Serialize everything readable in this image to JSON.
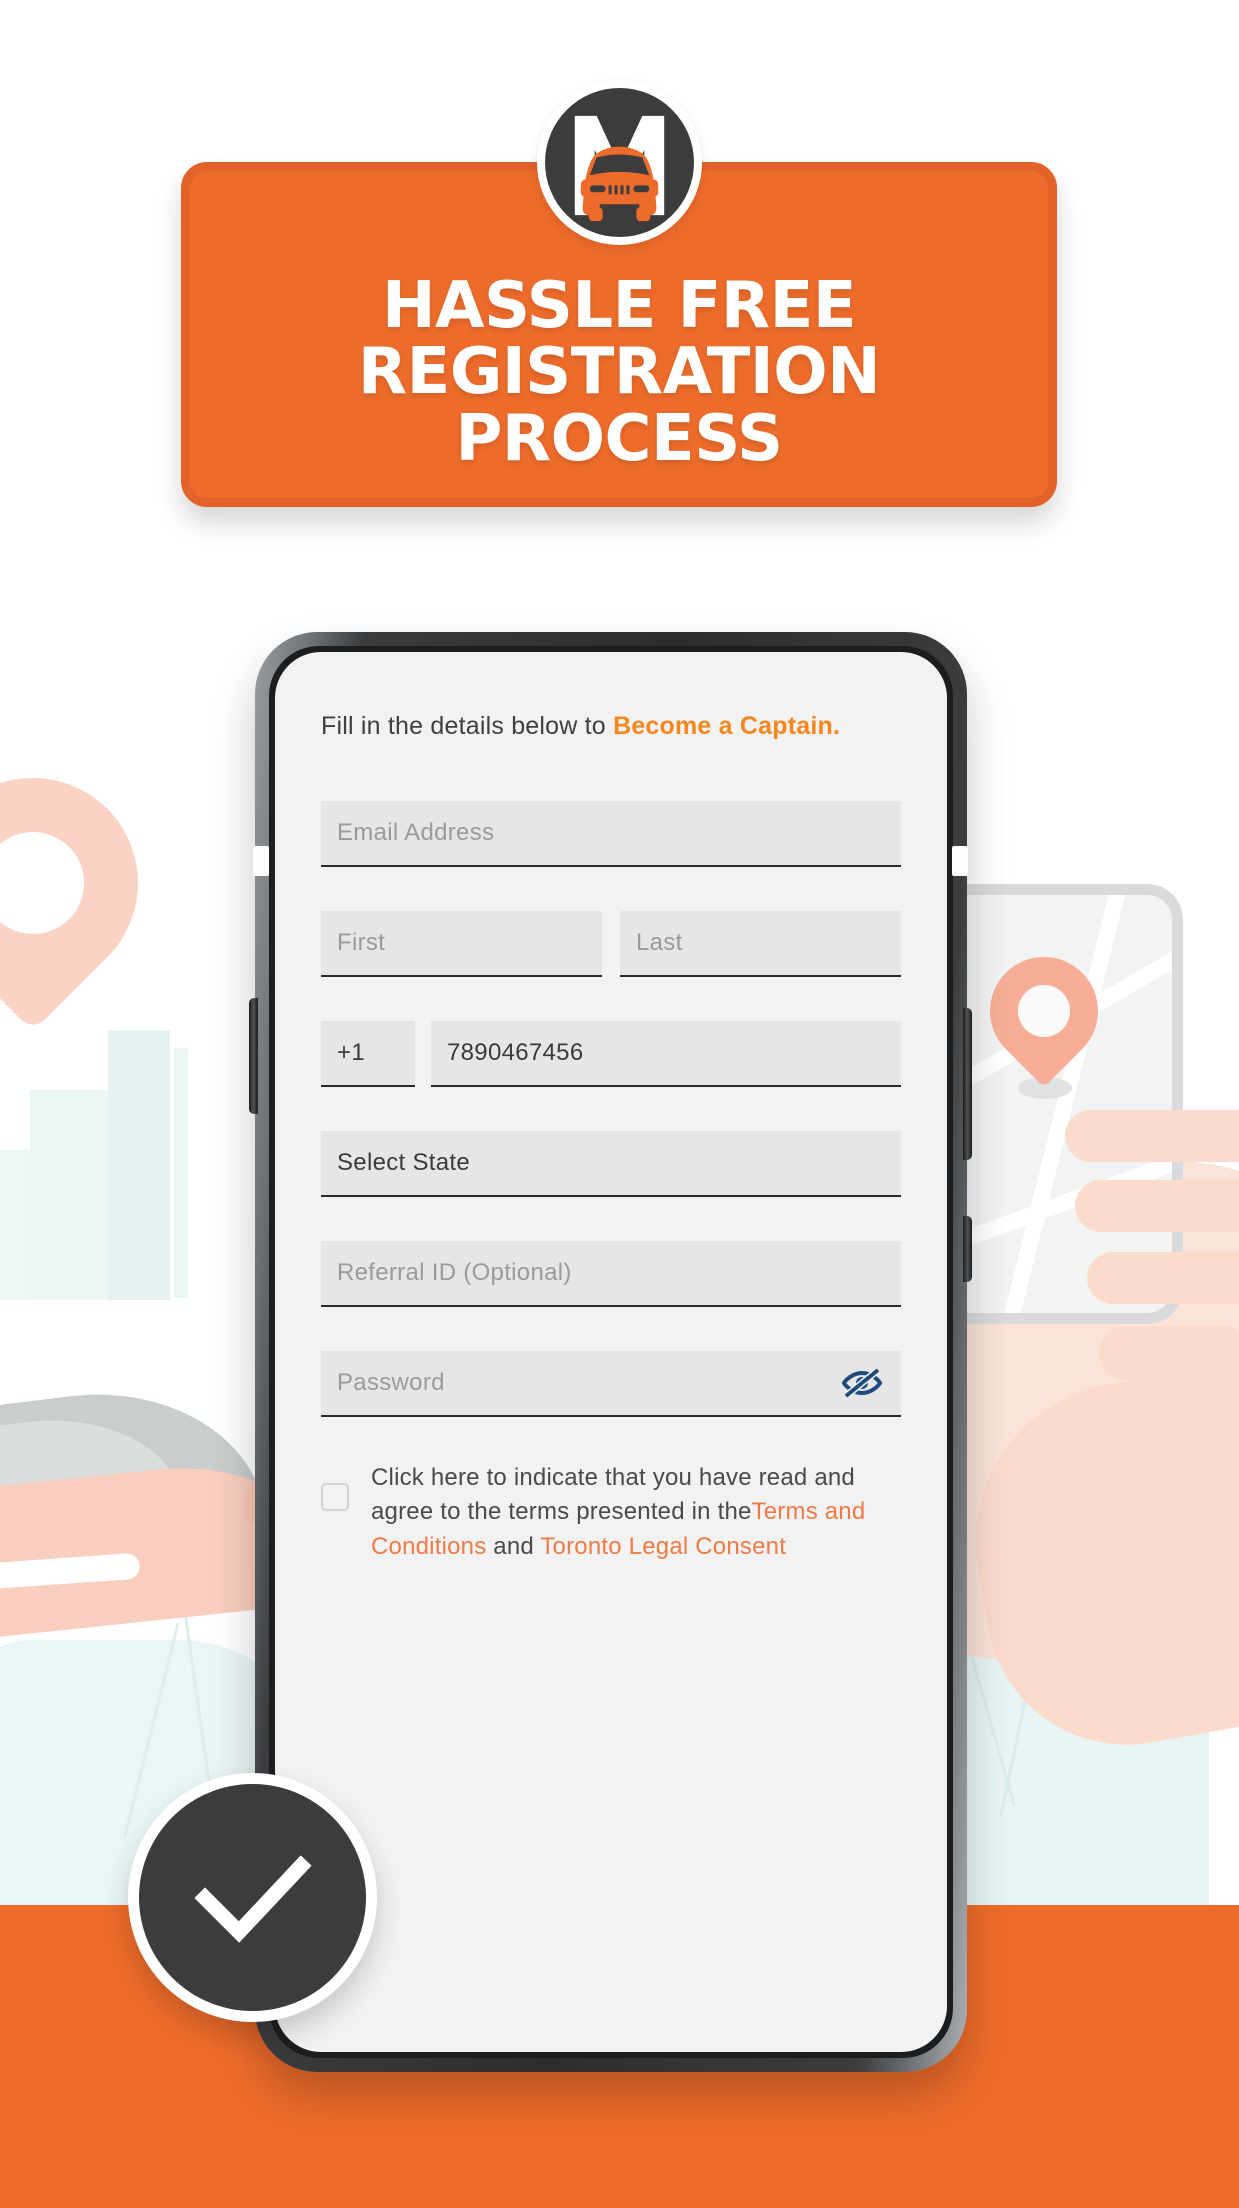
{
  "banner": {
    "title": "HASSLE FREE\nREGISTRATION\nPROCESS",
    "bg_color": "#EE6C2B",
    "border_color": "#E2622A",
    "text_color": "#FFFFFF"
  },
  "logo": {
    "name": "m-car-logo",
    "letter": "M",
    "circle_color": "#3C3C3C",
    "car_color": "#EE6C2B"
  },
  "form": {
    "lede_prefix": "Fill in the details below to ",
    "lede_highlight": "Become a Captain.",
    "fields": {
      "email_placeholder": "Email Address",
      "first_placeholder": "First",
      "last_placeholder": "Last",
      "country_code_value": "+1",
      "phone_value": "7890467456",
      "state_value": "Select State",
      "referral_placeholder": "Referral ID (Optional)",
      "password_placeholder": "Password"
    },
    "password_toggle_icon": "eye-slash-icon",
    "password_toggle_color": "#1E4B7D",
    "consent": {
      "line_1": "Click here to indicate that you have read and agree to the terms presented in the",
      "link_terms": "Terms and Conditions",
      "conjunction": " and ",
      "link_legal": "Toronto Legal Consent",
      "link_color": "#EE7B45",
      "checked": false
    }
  },
  "badge": {
    "icon": "check-icon",
    "bg_color": "#3C3C3C",
    "icon_color": "#FFFFFF"
  },
  "theme": {
    "orange": "#EE6C2B",
    "dark": "#3C3C3C",
    "screen_bg": "#F2F2F2",
    "field_bg": "#E6E6E6"
  }
}
